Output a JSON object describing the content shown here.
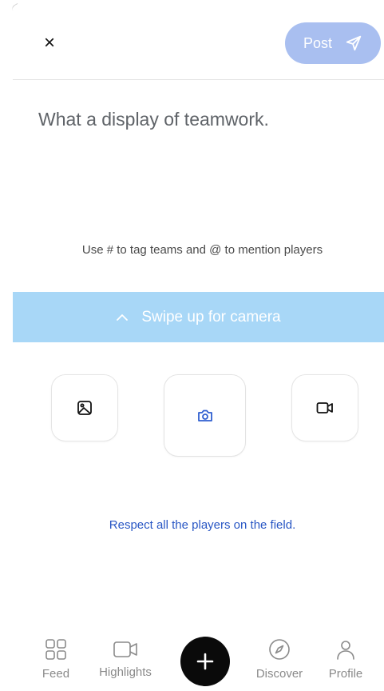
{
  "header": {
    "close_label": "×",
    "post_label": "Post",
    "post_button_color": "#a9bff0"
  },
  "composer": {
    "text": "What a display of teamwork.",
    "hint": "Use # to tag teams and @ to mention players"
  },
  "camera_banner": {
    "label": "Swipe up for camera",
    "color": "#a8d7f7",
    "icon": "chevron-up-icon"
  },
  "media_buttons": [
    {
      "icon": "image-icon"
    },
    {
      "icon": "camera-icon",
      "accent": "#2f5fd0"
    },
    {
      "icon": "video-icon"
    }
  ],
  "notice": {
    "text": "Respect all the players on the field.",
    "color": "#2856c4"
  },
  "bottom_nav": {
    "items": [
      {
        "label": "Feed",
        "icon": "grid-icon"
      },
      {
        "label": "Highlights",
        "icon": "video-icon"
      },
      {
        "label": "Discover",
        "icon": "compass-icon"
      },
      {
        "label": "Profile",
        "icon": "person-icon"
      }
    ],
    "fab_icon": "plus-icon"
  }
}
